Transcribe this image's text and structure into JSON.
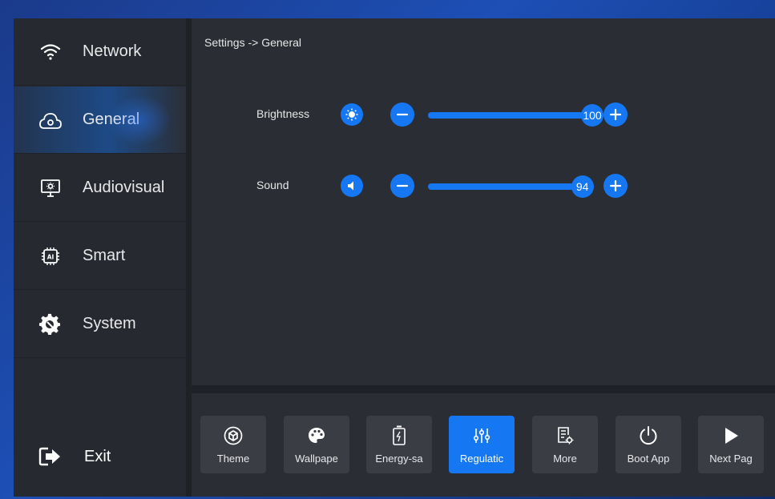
{
  "sidebar": {
    "items": [
      {
        "label": "Network",
        "icon": "wifi-icon"
      },
      {
        "label": "General",
        "icon": "cloud-settings-icon",
        "active": true
      },
      {
        "label": "Audiovisual",
        "icon": "monitor-icon"
      },
      {
        "label": "Smart",
        "icon": "ai-chip-icon"
      },
      {
        "label": "System",
        "icon": "gear-icon"
      }
    ],
    "exit_label": "Exit"
  },
  "main": {
    "breadcrumb": "Settings -> General",
    "brightness": {
      "label": "Brightness",
      "value": "100",
      "level": 100
    },
    "sound": {
      "label": "Sound",
      "value": "94",
      "level": 94
    }
  },
  "bottom": {
    "buttons": [
      {
        "label": "Theme",
        "icon": "cube-icon"
      },
      {
        "label": "Wallpape",
        "icon": "palette-icon"
      },
      {
        "label": "Energy-sa",
        "icon": "battery-icon"
      },
      {
        "label": "Regulatic",
        "icon": "sliders-icon",
        "active": true
      },
      {
        "label": "More",
        "icon": "document-settings-icon"
      },
      {
        "label": "Boot App",
        "icon": "power-icon"
      },
      {
        "label": "Next Pag",
        "icon": "play-icon"
      }
    ]
  },
  "colors": {
    "accent": "#1677f2",
    "panel": "#2a2d33",
    "sidebar": "#26292f"
  }
}
